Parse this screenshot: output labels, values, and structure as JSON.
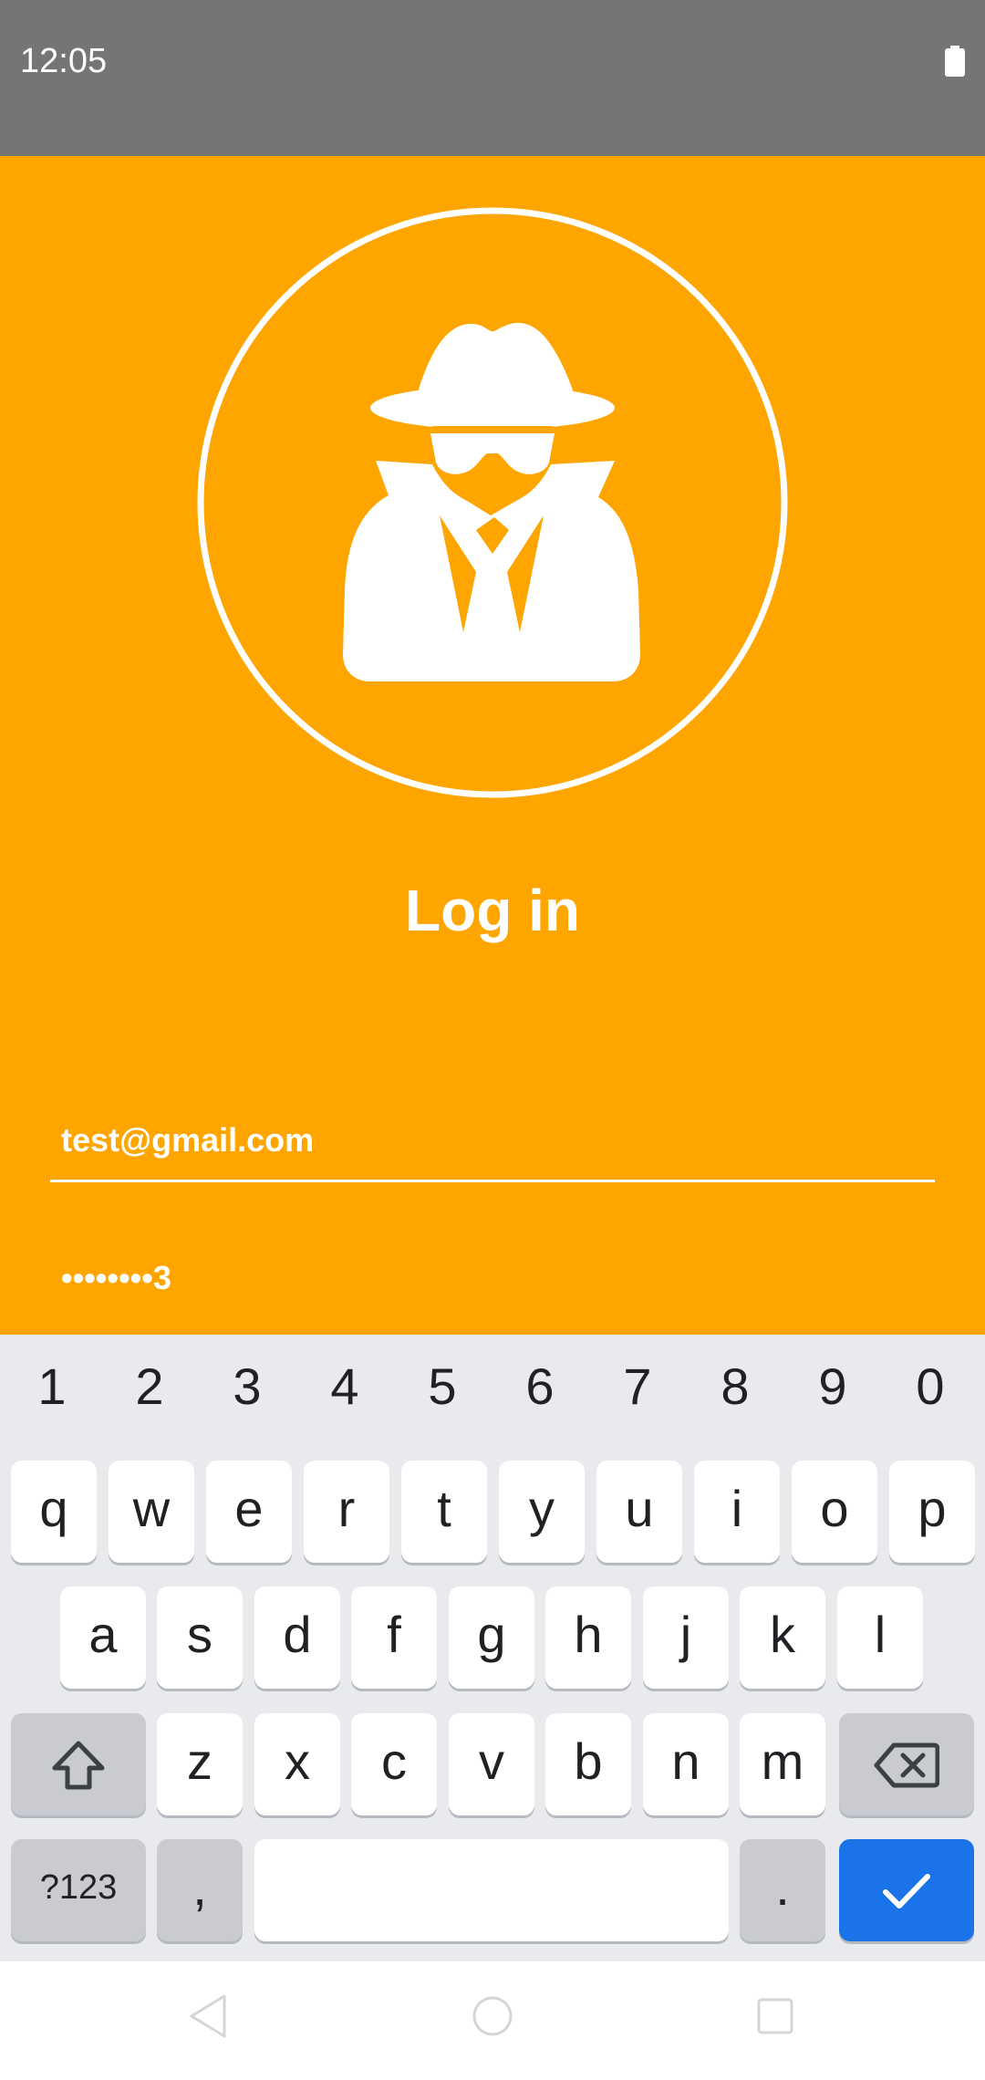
{
  "status_bar": {
    "time": "12:05",
    "icons": [
      "battery-icon"
    ]
  },
  "app": {
    "background_color": "#FFA500",
    "avatar_icon": "spy-icon",
    "title": "Log in",
    "email": {
      "value": "test@gmail.com"
    },
    "password": {
      "value": "••••••••3"
    }
  },
  "keyboard": {
    "number_row": [
      "1",
      "2",
      "3",
      "4",
      "5",
      "6",
      "7",
      "8",
      "9",
      "0"
    ],
    "row1": [
      "q",
      "w",
      "e",
      "r",
      "t",
      "y",
      "u",
      "i",
      "o",
      "p"
    ],
    "row2": [
      "a",
      "s",
      "d",
      "f",
      "g",
      "h",
      "j",
      "k",
      "l"
    ],
    "row3": [
      "z",
      "x",
      "c",
      "v",
      "b",
      "n",
      "m"
    ],
    "shift_icon": "shift-icon",
    "backspace_icon": "backspace-icon",
    "symbols_label": "?123",
    "comma_label": ",",
    "period_label": ".",
    "enter_icon": "check-icon",
    "enter_color": "#1A73E8"
  },
  "nav_bar": {
    "icons": [
      "back-icon",
      "home-icon",
      "recents-icon"
    ]
  }
}
